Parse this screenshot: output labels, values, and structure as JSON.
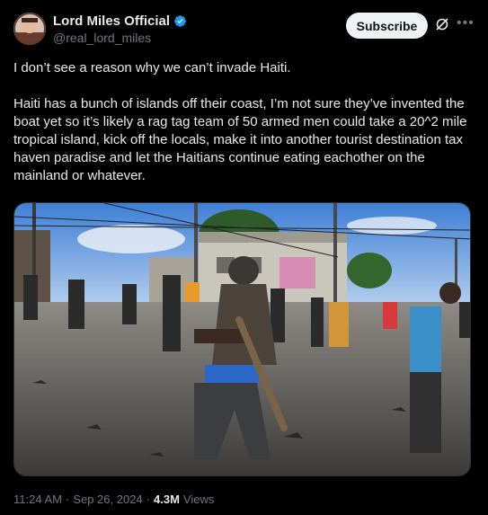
{
  "author": {
    "display_name": "Lord Miles Official",
    "handle": "@real_lord_miles"
  },
  "actions": {
    "subscribe_label": "Subscribe"
  },
  "tweet": {
    "paragraph_1": "I don’t see a reason why we can’t invade Haiti.",
    "paragraph_2": "Haiti has a bunch of islands off their coast, I’m not sure they’ve invented the boat yet so it’s likely a rag tag team of 50 armed men could take a 20^2 mile tropical island, kick off the locals, make it into another tourist destination tax haven paradise and let the Haitians continue eating eachother on the mainland or whatever."
  },
  "meta": {
    "time": "11:24 AM",
    "separator": "·",
    "date": "Sep 26, 2024",
    "views_count": "4.3M",
    "views_label": "Views"
  },
  "colors": {
    "background": "#000000",
    "text": "#e7e9ea",
    "secondary_text": "#71767b",
    "verified_blue": "#1d9bf0",
    "button_bg": "#eff3f4"
  },
  "icons": {
    "verified": "verified-badge-icon",
    "grok": "grok-icon",
    "more": "more-options-icon"
  }
}
